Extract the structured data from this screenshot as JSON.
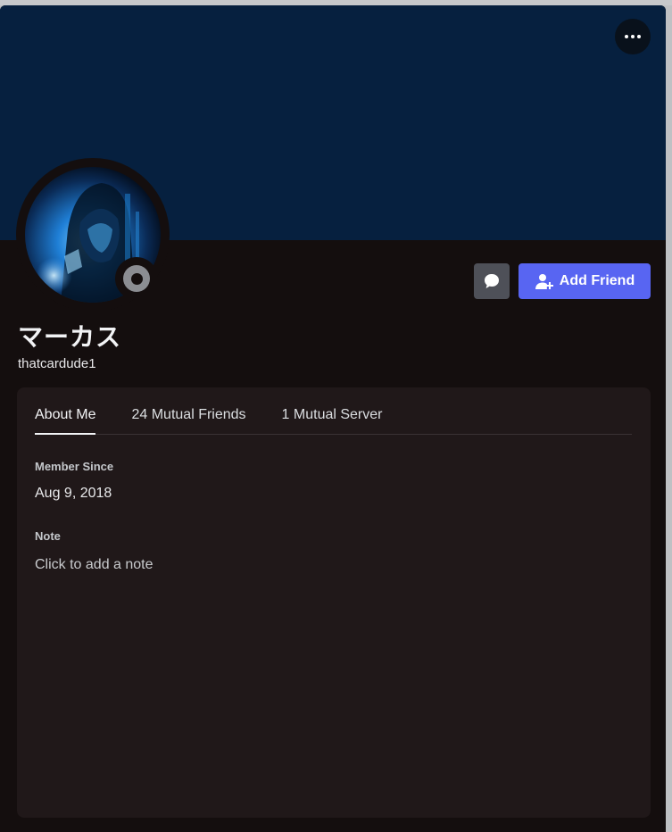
{
  "profile": {
    "display_name": "マーカス",
    "username": "thatcardude1",
    "status": "offline"
  },
  "actions": {
    "more_icon": "more-horizontal-icon",
    "message_icon": "chat-bubble-icon",
    "add_friend_icon": "add-user-icon",
    "add_friend_label": "Add Friend"
  },
  "tabs": [
    {
      "label": "About Me",
      "active": true
    },
    {
      "label": "24 Mutual Friends",
      "active": false
    },
    {
      "label": "1 Mutual Server",
      "active": false
    }
  ],
  "about": {
    "member_since_label": "Member Since",
    "member_since_value": "Aug 9, 2018",
    "note_label": "Note",
    "note_placeholder": "Click to add a note"
  },
  "colors": {
    "banner": "#06203f",
    "background": "#140e0e",
    "panel": "#201819",
    "accent": "#5865f2",
    "status_offline": "#8b8d92"
  }
}
